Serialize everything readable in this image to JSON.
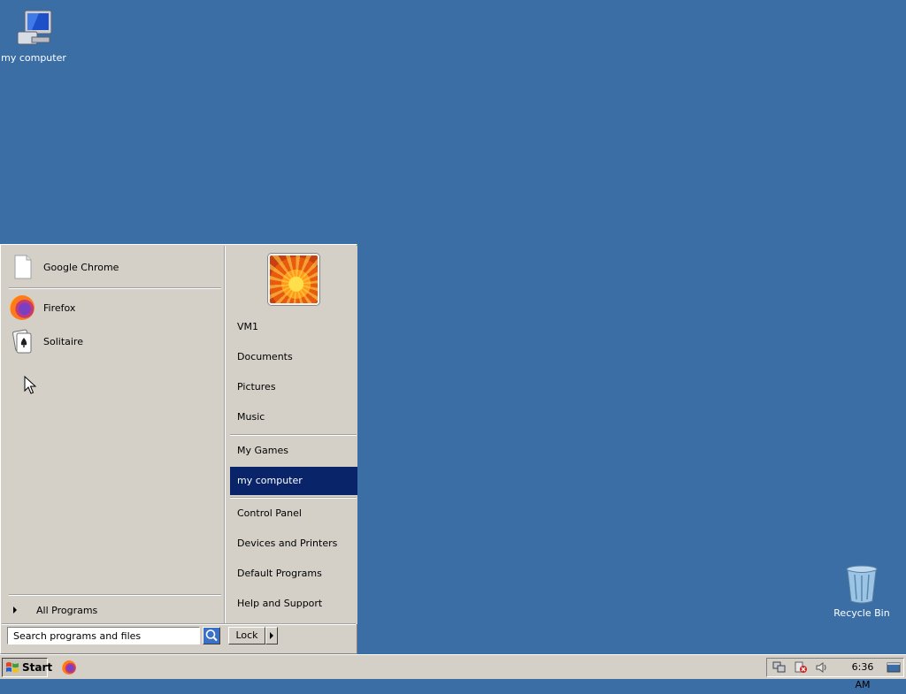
{
  "desktop": {
    "icons": [
      {
        "label": "my computer",
        "icon": "computer-icon"
      },
      {
        "label": "Recycle Bin",
        "icon": "recycle-bin-icon"
      }
    ]
  },
  "start_menu": {
    "pinned": [
      {
        "label": "Google Chrome",
        "icon": "blank-document-icon"
      }
    ],
    "recent": [
      {
        "label": "Firefox",
        "icon": "firefox-icon"
      },
      {
        "label": "Solitaire",
        "icon": "solitaire-icon"
      }
    ],
    "all_programs_label": "All Programs",
    "search": {
      "placeholder": "Search programs and files",
      "value": ""
    },
    "right_items": [
      {
        "label": "VM1"
      },
      {
        "label": "Documents"
      },
      {
        "label": "Pictures"
      },
      {
        "label": "Music"
      },
      {
        "label": "My Games"
      },
      {
        "label": "my computer",
        "selected": true
      },
      {
        "label": "Control Panel"
      },
      {
        "label": "Devices and Printers"
      },
      {
        "label": "Default Programs"
      },
      {
        "label": "Help and Support"
      }
    ],
    "lock_label": "Lock"
  },
  "taskbar": {
    "start_label": "Start",
    "clock": "6:36 AM",
    "selection_color": "#0a246a",
    "desktop_color": "#3a6ea5"
  }
}
